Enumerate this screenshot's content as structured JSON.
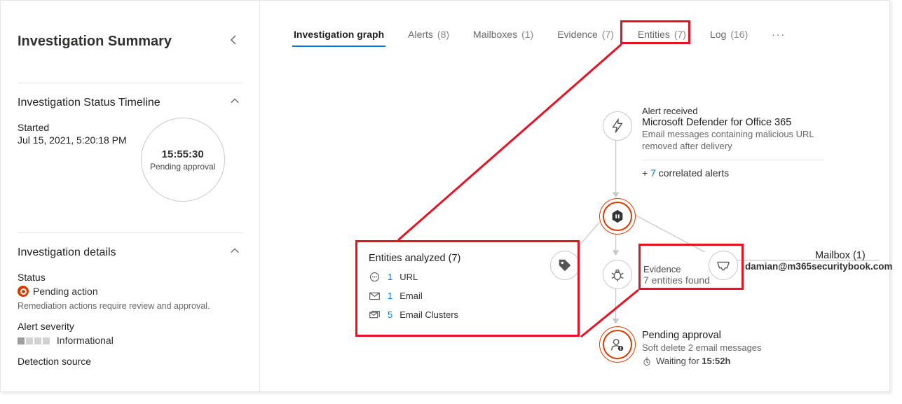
{
  "sidebar": {
    "title": "Investigation Summary",
    "timeline": {
      "heading": "Investigation Status Timeline",
      "started_label": "Started",
      "started_ts": "Jul 15, 2021, 5:20:18 PM",
      "timer": "15:55:30",
      "timer_caption": "Pending approval"
    },
    "details": {
      "heading": "Investigation details",
      "status_label": "Status",
      "status_value": "Pending action",
      "status_note": "Remediation actions require review and approval.",
      "severity_label": "Alert severity",
      "severity_value": "Informational",
      "detection_label": "Detection source"
    }
  },
  "tabs": [
    {
      "label": "Investigation graph",
      "count": "",
      "active": true
    },
    {
      "label": "Alerts",
      "count": "(8)"
    },
    {
      "label": "Mailboxes",
      "count": "(1)"
    },
    {
      "label": "Evidence",
      "count": "(7)"
    },
    {
      "label": "Entities",
      "count": "(7)"
    },
    {
      "label": "Log",
      "count": "(16)"
    }
  ],
  "graph": {
    "alert_received": {
      "l1": "Alert received",
      "l2": "Microsoft Defender for Office 365",
      "l3": "Email messages containing malicious URL removed after delivery"
    },
    "correlated": {
      "prefix": "+ ",
      "count": "7",
      "suffix": " correlated alerts"
    },
    "entities": {
      "heading": "Entities analyzed (7)",
      "rows": [
        {
          "count": "1",
          "label": "URL"
        },
        {
          "count": "1",
          "label": "Email"
        },
        {
          "count": "5",
          "label": "Email Clusters"
        }
      ]
    },
    "evidence": {
      "l1": "Evidence",
      "l2": "7 entities found"
    },
    "mailbox": {
      "heading": "Mailbox (1)",
      "address": "damian@m365securitybook.com"
    },
    "pending": {
      "l1": "Pending approval",
      "l2": "Soft delete 2 email messages",
      "l3_prefix": "Waiting for ",
      "l3_time": "15:52h"
    }
  }
}
